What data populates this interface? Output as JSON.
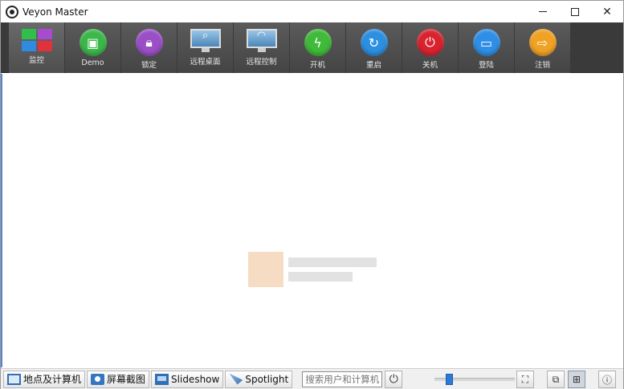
{
  "window": {
    "title": "Veyon Master"
  },
  "toolbar": {
    "items": [
      {
        "label": "监控",
        "icon": "monitor-grid-icon"
      },
      {
        "label": "Demo",
        "icon": "demo-icon",
        "color": "#3cb84a"
      },
      {
        "label": "锁定",
        "icon": "lock-icon",
        "color": "#9b4fc6"
      },
      {
        "label": "远程桌面",
        "icon": "remote-view-icon"
      },
      {
        "label": "远程控制",
        "icon": "remote-control-icon"
      },
      {
        "label": "开机",
        "icon": "power-on-icon",
        "color": "#3fba3a"
      },
      {
        "label": "重启",
        "icon": "reboot-icon",
        "color": "#2d8fe0"
      },
      {
        "label": "关机",
        "icon": "shutdown-icon",
        "color": "#d9232f"
      },
      {
        "label": "登陆",
        "icon": "login-icon",
        "color": "#2f8fe6"
      },
      {
        "label": "注销",
        "icon": "logout-icon",
        "color": "#f0a225"
      }
    ]
  },
  "statusbar": {
    "locations_label": "地点及计算机",
    "screenshots_label": "屏幕截图",
    "slideshow_label": "Slideshow",
    "spotlight_label": "Spotlight",
    "search_placeholder": "搜索用户和计算机",
    "zoom_value": 0.15
  }
}
